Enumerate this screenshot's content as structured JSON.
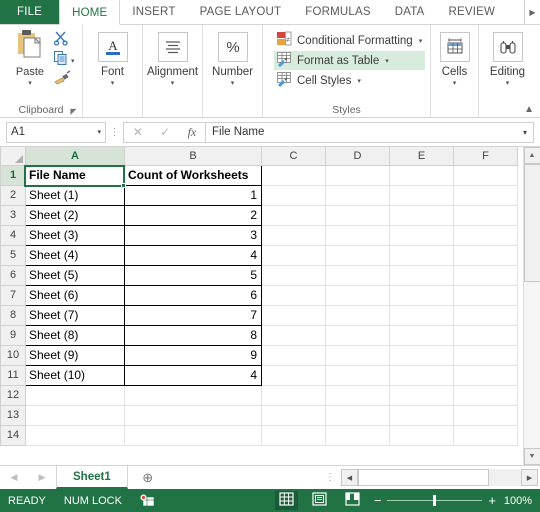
{
  "ribbon": {
    "tabs": [
      {
        "label": "FILE",
        "type": "file"
      },
      {
        "label": "HOME",
        "type": "active"
      },
      {
        "label": "INSERT",
        "type": "normal"
      },
      {
        "label": "PAGE LAYOUT",
        "type": "normal"
      },
      {
        "label": "FORMULAS",
        "type": "normal"
      },
      {
        "label": "DATA",
        "type": "normal"
      },
      {
        "label": "REVIEW",
        "type": "normal"
      }
    ],
    "more_tabs_icon": "chevron-right-icon",
    "collapse_icon": "chevron-up-icon",
    "groups": {
      "clipboard": {
        "title": "Clipboard",
        "paste_label": "Paste",
        "paste_icon": "clipboard-icon",
        "cut_icon": "scissors-icon",
        "copy_icon": "copy-icon",
        "format_painter_icon": "paintbrush-icon",
        "launcher_icon": "dialog-launcher-icon"
      },
      "font": {
        "title": "Font",
        "label": "Font",
        "icon": "font-a-icon"
      },
      "alignment": {
        "title": "Alignment",
        "label": "Alignment",
        "icon": "align-lines-icon"
      },
      "number": {
        "title": "Number",
        "label": "Number",
        "icon": "percent-icon"
      },
      "styles": {
        "title": "Styles",
        "items": [
          {
            "label": "Conditional Formatting",
            "icon": "conditional-formatting-icon",
            "arrow": "▾",
            "hover": false
          },
          {
            "label": "Format as Table",
            "icon": "format-as-table-icon",
            "arrow": "▾",
            "hover": true
          },
          {
            "label": "Cell Styles",
            "icon": "cell-styles-icon",
            "arrow": "▾",
            "hover": false
          }
        ]
      },
      "cells": {
        "title": "",
        "label": "Cells",
        "icon": "cells-insert-icon"
      },
      "editing": {
        "title": "",
        "label": "Editing",
        "icon": "binoculars-icon"
      }
    }
  },
  "formula_bar": {
    "name_box_value": "A1",
    "name_box_arrow": "˅",
    "cancel_icon": "cancel-x-icon",
    "enter_icon": "check-icon",
    "function_icon": "fx-icon",
    "formula_value": "File Name",
    "expand_arrow": "˅"
  },
  "grid": {
    "columns": [
      "A",
      "B",
      "C",
      "D",
      "E",
      "F"
    ],
    "selected_column": "A",
    "selected_row": 1,
    "rows": [
      {
        "n": 1,
        "a": "File Name",
        "b": "Count of Worksheets",
        "bordered": true,
        "header": true
      },
      {
        "n": 2,
        "a": "Sheet (1)",
        "b": "1",
        "bordered": true,
        "header": false
      },
      {
        "n": 3,
        "a": "Sheet (2)",
        "b": "2",
        "bordered": true,
        "header": false
      },
      {
        "n": 4,
        "a": "Sheet (3)",
        "b": "3",
        "bordered": true,
        "header": false
      },
      {
        "n": 5,
        "a": "Sheet (4)",
        "b": "4",
        "bordered": true,
        "header": false
      },
      {
        "n": 6,
        "a": "Sheet (5)",
        "b": "5",
        "bordered": true,
        "header": false
      },
      {
        "n": 7,
        "a": "Sheet (6)",
        "b": "6",
        "bordered": true,
        "header": false
      },
      {
        "n": 8,
        "a": "Sheet (7)",
        "b": "7",
        "bordered": true,
        "header": false
      },
      {
        "n": 9,
        "a": "Sheet (8)",
        "b": "8",
        "bordered": true,
        "header": false
      },
      {
        "n": 10,
        "a": "Sheet (9)",
        "b": "9",
        "bordered": true,
        "header": false
      },
      {
        "n": 11,
        "a": "Sheet (10)",
        "b": "4",
        "bordered": true,
        "header": false
      },
      {
        "n": 12,
        "a": "",
        "b": "",
        "bordered": false,
        "header": false
      },
      {
        "n": 13,
        "a": "",
        "b": "",
        "bordered": false,
        "header": false
      },
      {
        "n": 14,
        "a": "",
        "b": "",
        "bordered": false,
        "header": false
      }
    ],
    "scroll_up_icon": "scroll-up-arrow-icon",
    "scroll_down_icon": "scroll-down-arrow-icon"
  },
  "sheet_tabs": {
    "first_arrow_icon": "nav-first-icon",
    "last_arrow_icon": "nav-last-icon",
    "tabs": [
      {
        "label": "Sheet1",
        "active": true
      }
    ],
    "new_sheet_icon": "plus-circle-icon",
    "split_dots": "⋮",
    "hscroll_left_icon": "scroll-left-arrow-icon",
    "hscroll_right_icon": "scroll-right-arrow-icon"
  },
  "status_bar": {
    "state": "READY",
    "num_lock": "NUM LOCK",
    "macro_icon": "record-macro-icon",
    "views": [
      {
        "name": "normal-view",
        "icon": "grid-view-icon",
        "active": true
      },
      {
        "name": "page-layout-view",
        "icon": "page-layout-icon",
        "active": false
      },
      {
        "name": "page-break-view",
        "icon": "page-break-icon",
        "active": false
      }
    ],
    "zoom_out": "−",
    "zoom_in": "+",
    "zoom_level": "100%"
  },
  "colors": {
    "excel_green": "#217346",
    "status_green": "#217346",
    "hover_green": "#d8ecdd",
    "header_gray": "#f0f0f0"
  }
}
